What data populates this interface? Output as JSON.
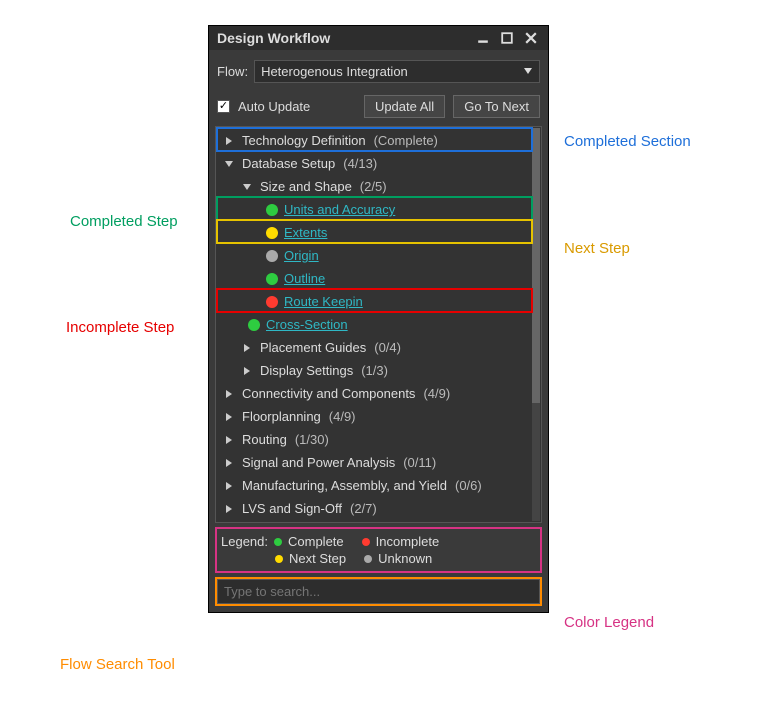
{
  "window": {
    "title": "Design Workflow"
  },
  "flow": {
    "label": "Flow:",
    "value": "Heterogenous Integration"
  },
  "controls": {
    "auto_update": "Auto Update",
    "update_all": "Update All",
    "go_to_next": "Go To Next"
  },
  "tree": {
    "tech_def": {
      "label": "Technology Definition",
      "status": "(Complete)"
    },
    "db_setup": {
      "label": "Database Setup",
      "count": "(4/13)"
    },
    "size_shape": {
      "label": "Size and Shape",
      "count": "(2/5)"
    },
    "units": "Units and Accuracy",
    "extents": "Extents",
    "origin": "Origin",
    "outline": "Outline",
    "route_keepin": "Route Keepin",
    "cross_section": "Cross-Section",
    "placement_guides": {
      "label": "Placement Guides",
      "count": "(0/4)"
    },
    "display_settings": {
      "label": "Display Settings",
      "count": "(1/3)"
    },
    "connectivity": {
      "label": "Connectivity and Components",
      "count": "(4/9)"
    },
    "floorplanning": {
      "label": "Floorplanning",
      "count": "(4/9)"
    },
    "routing": {
      "label": "Routing",
      "count": "(1/30)"
    },
    "signal_power": {
      "label": "Signal and Power Analysis",
      "count": "(0/11)"
    },
    "mfg": {
      "label": "Manufacturing, Assembly, and Yield",
      "count": "(0/6)"
    },
    "lvs": {
      "label": "LVS and Sign-Off",
      "count": "(2/7)"
    }
  },
  "legend": {
    "label": "Legend:",
    "complete": "Complete",
    "incomplete": "Incomplete",
    "next_step": "Next Step",
    "unknown": "Unknown"
  },
  "search": {
    "placeholder": "Type to search..."
  },
  "callouts": {
    "completed_section": "Completed Section",
    "completed_step": "Completed Step",
    "next_step": "Next Step",
    "incomplete_step": "Incomplete Step",
    "color_legend": "Color Legend",
    "flow_search": "Flow Search Tool"
  }
}
